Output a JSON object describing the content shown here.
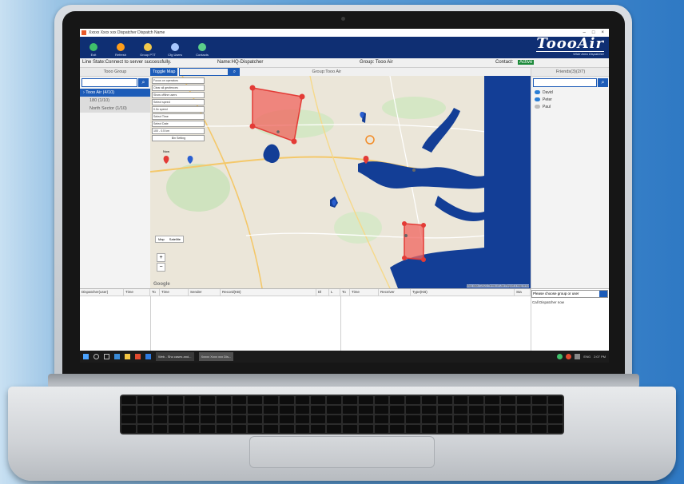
{
  "window": {
    "title": "Xxxxx Xxxx xxx Dispatcher  Dispatch Name"
  },
  "toolbar": {
    "buttons": [
      {
        "label": "Exit",
        "icon": "exit-icon",
        "color": "#3fbf6a"
      },
      {
        "label": "Refresh",
        "icon": "refresh-icon",
        "color": "#ff9d1a"
      },
      {
        "label": "Group PTT",
        "icon": "ptt-icon",
        "color": "#f2c94c"
      },
      {
        "label": "Cfg Users",
        "icon": "users-icon",
        "color": "#a7c7ff"
      },
      {
        "label": "Contacts",
        "icon": "contacts-icon",
        "color": "#5ccf8a"
      }
    ],
    "logo": "ToooAir",
    "logo_sub": "Wide Area Dispatcher"
  },
  "status": {
    "line_state": "Line State:Connect to server successfully.",
    "name": "Name:HQ-Dispatcher",
    "group": "Group: Tooo Air",
    "contact": "Contact:",
    "contact_value": "Active"
  },
  "left_panel": {
    "header": "Tooo Group",
    "groups": [
      {
        "label": "Tooo Air (4/10)",
        "active": true
      },
      {
        "label": "180 (1/10)",
        "active": false
      },
      {
        "label": "North Sector (1/10)",
        "active": false
      }
    ]
  },
  "map": {
    "toggle_label": "Toggle Map",
    "group_label": "Group:Tooo Air",
    "controls": [
      "Focus on operators",
      "Clear all geofences",
      "Show offline users",
      "Select speed",
      "0.5x speed",
      "Select Time",
      "Select Date",
      "100 - 0.5 km",
      "Bin Setting"
    ],
    "legend_label": "Now",
    "map_type_map": "Map",
    "map_type_sat": "Satellite",
    "zoom_in": "+",
    "zoom_out": "−",
    "google": "Google",
    "footer": "Map data ©2023   Terms of Use   Report a map error",
    "land_color": "#ebe6d9",
    "water_color": "#133e96",
    "geofence_color": "#f0645e"
  },
  "right_panel": {
    "header": "Friends(3)(2/7)",
    "friends": [
      {
        "label": "David",
        "online": true
      },
      {
        "label": "Peter",
        "online": true
      },
      {
        "label": "Paul",
        "online": false
      }
    ]
  },
  "bottom": {
    "pane1_cols": [
      "Dispatcher(user)",
      "Time"
    ],
    "pane2_cols": [
      "To",
      "Time",
      "Sender",
      "Record(KB)",
      "Dl",
      "L"
    ],
    "pane3_cols": [
      "To",
      "Time",
      "Receiver",
      "Type(KB)",
      "Sta"
    ],
    "notice_placeholder": "Please choose group or user",
    "notice_text": "Call Dispatcher now"
  },
  "taskbar": {
    "apps": [
      "Web - Sho cases and...",
      "Xxxxx Xxxx xxx Dis..."
    ],
    "lang": "ENG",
    "clock": "2:07 PM"
  }
}
